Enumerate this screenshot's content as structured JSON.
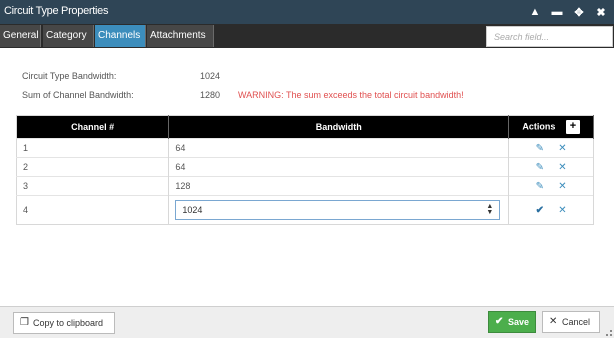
{
  "window": {
    "title": "Circuit Type Properties",
    "controls": {
      "collapse": "▲",
      "minimize": "▬",
      "maximize": "✥",
      "close": "✖"
    }
  },
  "tabs": [
    {
      "label": "General",
      "active": false
    },
    {
      "label": "Category",
      "active": false
    },
    {
      "label": "Channels",
      "active": true
    },
    {
      "label": "Attachments",
      "active": false
    }
  ],
  "search": {
    "placeholder": "Search field...",
    "value": ""
  },
  "info": {
    "bandwidth_label": "Circuit Type Bandwidth:",
    "bandwidth_value": "1024",
    "sum_label": "Sum of Channel Bandwidth:",
    "sum_value": "1280",
    "warning": "WARNING: The sum exceeds the total circuit bandwidth!"
  },
  "table": {
    "headers": {
      "channel": "Channel #",
      "bandwidth": "Bandwidth",
      "actions": "Actions"
    },
    "add_icon": "+",
    "rows": [
      {
        "channel": "1",
        "bandwidth": "64"
      },
      {
        "channel": "2",
        "bandwidth": "64"
      },
      {
        "channel": "3",
        "bandwidth": "128"
      }
    ],
    "edit_row": {
      "channel": "4",
      "bandwidth_value": "1024"
    },
    "icons": {
      "edit": "✎",
      "delete": "✕",
      "confirm": "✔"
    }
  },
  "footer": {
    "copy_label": "Copy to clipboard",
    "save_label": "Save",
    "cancel_label": "Cancel",
    "copy_icon": "❐",
    "save_icon": "✔",
    "cancel_icon": "✕"
  },
  "colors": {
    "titlebar": "#2f4556",
    "tab_active": "#3c8dbc",
    "warning": "#e05050",
    "save": "#4cae4c"
  }
}
